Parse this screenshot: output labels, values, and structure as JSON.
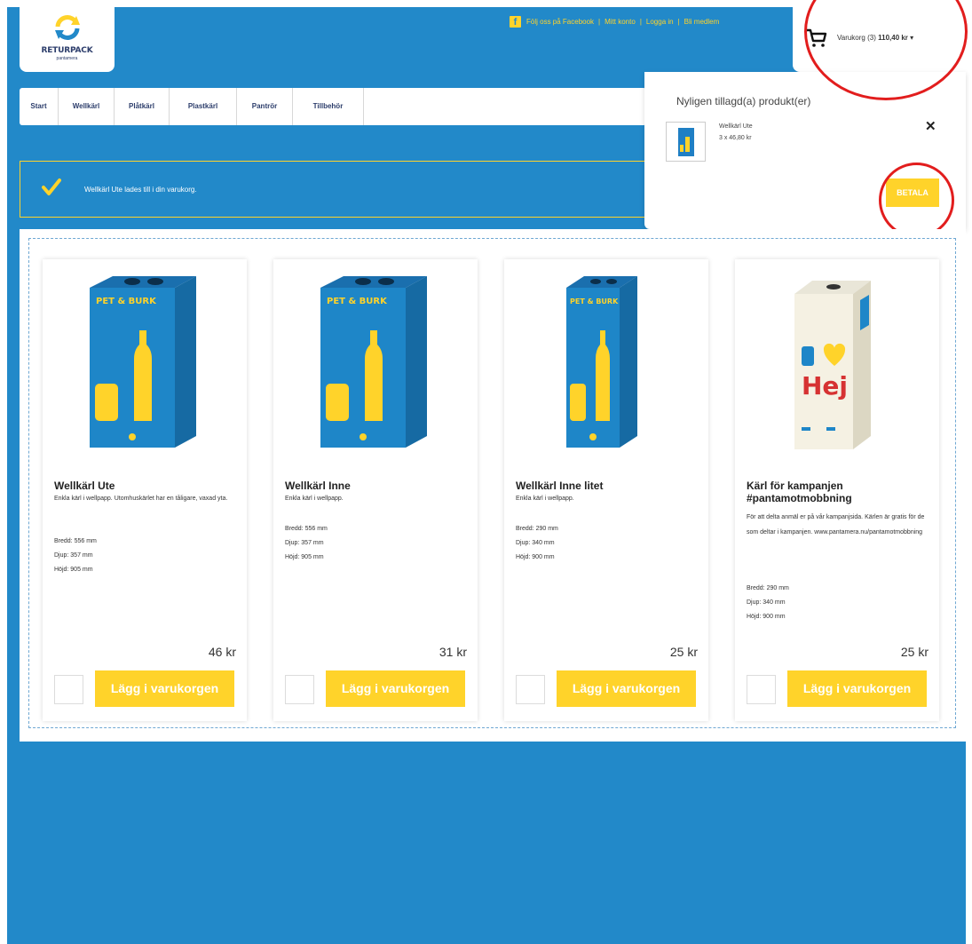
{
  "header": {
    "logo_text": "RETURPACK",
    "logo_sub": "pantamera",
    "facebook_link": "Följ oss på Facebook",
    "links": [
      "Mitt konto",
      "Logga in",
      "Bli medlem"
    ],
    "cart_label": "Varukorg (3)",
    "cart_total": "110,40 kr",
    "cart_caret": "▾"
  },
  "nav": {
    "items": [
      "Start",
      "Wellkärl",
      "Plåtkärl",
      "Plastkärl",
      "Pantrör",
      "Tillbehör"
    ]
  },
  "alert": {
    "message": "Wellkärl Ute lades till i din varukorg."
  },
  "cart_dropdown": {
    "title": "Nyligen tillagd(a) produkt(er)",
    "item_name": "Wellkärl Ute",
    "item_qty": "3 x 46,80 kr",
    "close": "✕",
    "pay_button": "BETALA"
  },
  "products": [
    {
      "title": "Wellkärl Ute",
      "desc": "Enkla kärl i wellpapp. Utomhuskärlet har en tåligare, vaxad yta.",
      "specs": [
        "Bredd: 556 mm",
        "Djup: 357 mm",
        "Höjd: 905 mm"
      ],
      "price": "46 kr",
      "button": "Lägg i varukorgen",
      "image_label": "PET & BURK"
    },
    {
      "title": "Wellkärl Inne",
      "desc": "Enkla kärl i wellpapp.",
      "specs": [
        "Bredd: 556 mm",
        "Djup: 357 mm",
        "Höjd: 905 mm"
      ],
      "price": "31 kr",
      "button": "Lägg i varukorgen",
      "image_label": "PET & BURK"
    },
    {
      "title": "Wellkärl Inne litet",
      "desc": "Enkla kärl i wellpapp.",
      "specs": [
        "Bredd: 290 mm",
        "Djup: 340 mm",
        "Höjd: 900 mm"
      ],
      "price": "25 kr",
      "button": "Lägg i varukorgen",
      "image_label": "PET & BURK"
    },
    {
      "title": "Kärl för kampanjen #pantamotmobbning",
      "desc": "För att delta anmäl er på vår kampanjsida. Kärlen är gratis för de som deltar i kampanjen. www.pantamera.nu/pantamotmobbning",
      "specs": [
        "Bredd: 290 mm",
        "Djup: 340 mm",
        "Höjd: 900 mm"
      ],
      "price": "25 kr",
      "button": "Lägg i varukorgen",
      "image_label": "Hej"
    }
  ],
  "colors": {
    "brand_blue": "#2289c9",
    "accent_yellow": "#ffd32a",
    "annotation_red": "#e21d1d"
  }
}
